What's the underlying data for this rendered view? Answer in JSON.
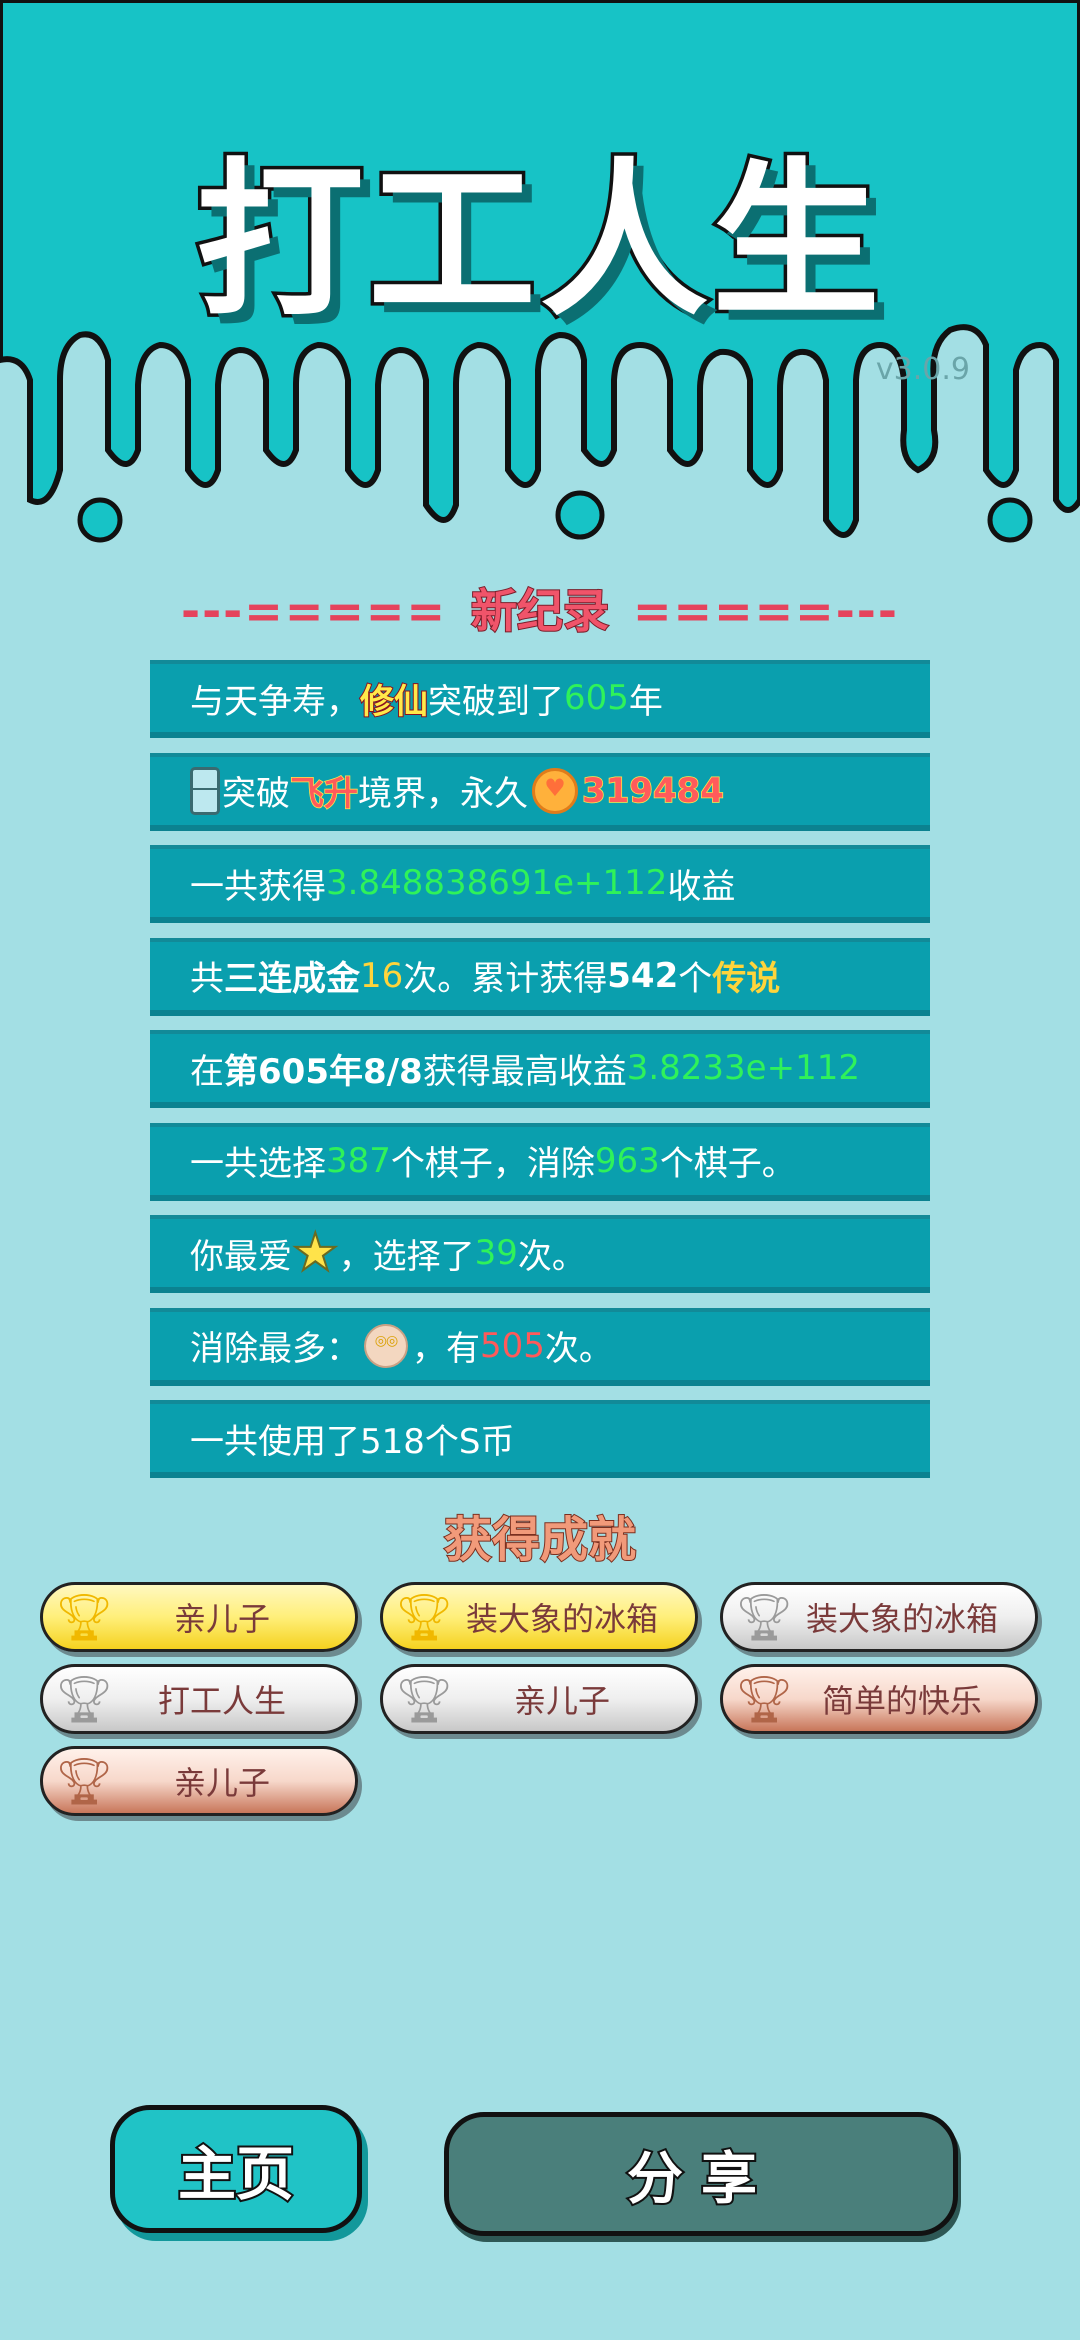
{
  "game": {
    "title": "打工人生",
    "version": "v3.0.9"
  },
  "record": {
    "title": "新纪录",
    "deco_left": "---=====",
    "deco_right": "=====---"
  },
  "stats": {
    "row1": {
      "pre": "与天争寿，",
      "hl": "修仙",
      "mid": "突破到了",
      "num": "605",
      "post": "年"
    },
    "row2": {
      "pre": "突破",
      "hl": "飞升",
      "mid": "境界，永久",
      "num": "319484"
    },
    "row3": {
      "pre": "一共获得",
      "num": "3.848838691e+112",
      "post": "收益"
    },
    "row4": {
      "pre": "共",
      "bold1": "三连成金",
      "num1": "16",
      "mid": "次。累计获得",
      "bold2": "542",
      "mid2": "个",
      "hl": "传说"
    },
    "row5": {
      "pre": "在 ",
      "bold": "第605年8/8",
      "mid": " 获得最高收益",
      "num": "3.8233e+112"
    },
    "row6": {
      "pre": "一共选择",
      "num1": "387",
      "mid": "个棋子，消除",
      "num2": "963",
      "post": "个棋子。"
    },
    "row7": {
      "pre": "你最爱",
      "mid": "，选择了",
      "num": "39",
      "post": "次。"
    },
    "row8": {
      "pre": "消除最多：",
      "mid": "，有",
      "num": "505",
      "post": "次。"
    },
    "row9": {
      "text": "一共使用了518个S币"
    }
  },
  "achievements": {
    "title": "获得成就",
    "items": [
      {
        "name": "亲儿子",
        "tier": "gold"
      },
      {
        "name": "装大象的冰箱",
        "tier": "gold"
      },
      {
        "name": "装大象的冰箱",
        "tier": "silver"
      },
      {
        "name": "打工人生",
        "tier": "silver"
      },
      {
        "name": "亲儿子",
        "tier": "silver"
      },
      {
        "name": "简单的快乐",
        "tier": "bronze"
      },
      {
        "name": "亲儿子",
        "tier": "bronze"
      }
    ]
  },
  "buttons": {
    "home": "主页",
    "share": "分享"
  },
  "colors": {
    "header": "#17c3c6",
    "background": "#a3dfe4",
    "stat_row": "#0a9fae",
    "highlight_green": "#2ff25a"
  }
}
